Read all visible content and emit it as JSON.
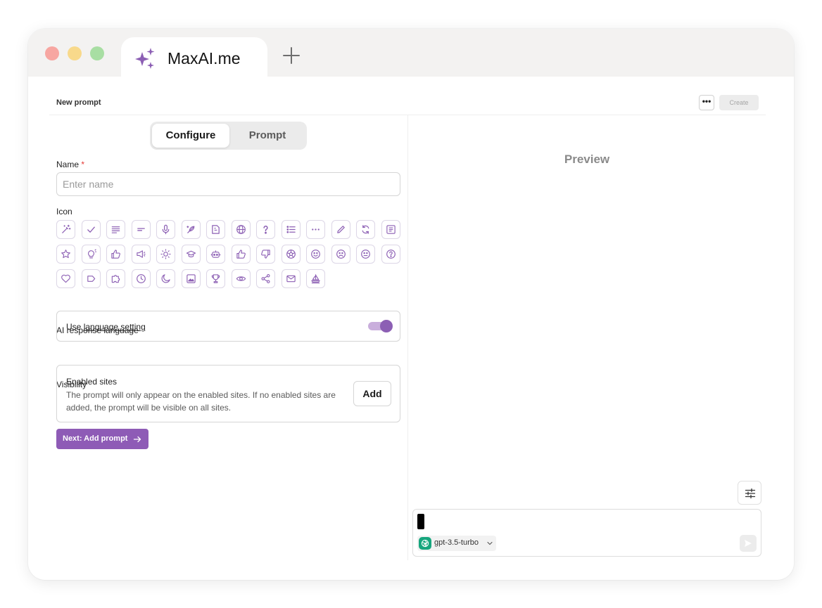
{
  "browser": {
    "tab_title": "MaxAI.me",
    "logo_icon": "sparkles-icon",
    "new_tab_icon": "plus-icon"
  },
  "header": {
    "title": "New prompt",
    "more_label": "•••",
    "create_label": "Create"
  },
  "tabs": {
    "configure": "Configure",
    "prompt": "Prompt"
  },
  "form": {
    "name_label": "Name",
    "name_required_marker": "*",
    "name_placeholder": "Enter name",
    "icon_label": "Icon",
    "icons": [
      "magic-wand-icon",
      "check-icon",
      "text-align-icon",
      "short-text-icon",
      "microphone-icon",
      "feather-pen-icon",
      "document-icon",
      "globe-icon",
      "question-icon",
      "bullet-list-icon",
      "more-horizontal-icon",
      "pencil-icon",
      "refresh-icon",
      "article-icon",
      "star-icon",
      "lightbulb-icon",
      "thumbs-up-icon",
      "megaphone-icon",
      "sun-icon",
      "graduation-cap-icon",
      "robot-icon",
      "thumbs-up-outline-icon",
      "thumbs-down-icon",
      "soccer-ball-icon",
      "smile-icon",
      "sad-icon",
      "neutral-face-icon",
      "help-circle-icon",
      "heart-icon",
      "label-icon",
      "puzzle-icon",
      "clock-icon",
      "moon-icon",
      "image-icon",
      "trophy-icon",
      "eye-icon",
      "share-icon",
      "mail-icon",
      "sailboat-icon"
    ],
    "language_label": "AI response language",
    "language_use": "Use",
    "language_link": "language setting",
    "language_toggle_on": true,
    "visibility_label": "Visibility",
    "enabled_sites_title": "Enabled sites",
    "enabled_sites_desc": "The prompt will only appear on the enabled sites. If no enabled sites are added, the prompt will be visible on all sites.",
    "add_label": "Add",
    "next_label": "Next: Add prompt"
  },
  "preview": {
    "title": "Preview",
    "model_name": "gpt-3.5-turbo"
  },
  "colors": {
    "accent": "#8e5bb6",
    "icon_stroke": "#8c5fb4",
    "model_logo": "#17a67e"
  }
}
